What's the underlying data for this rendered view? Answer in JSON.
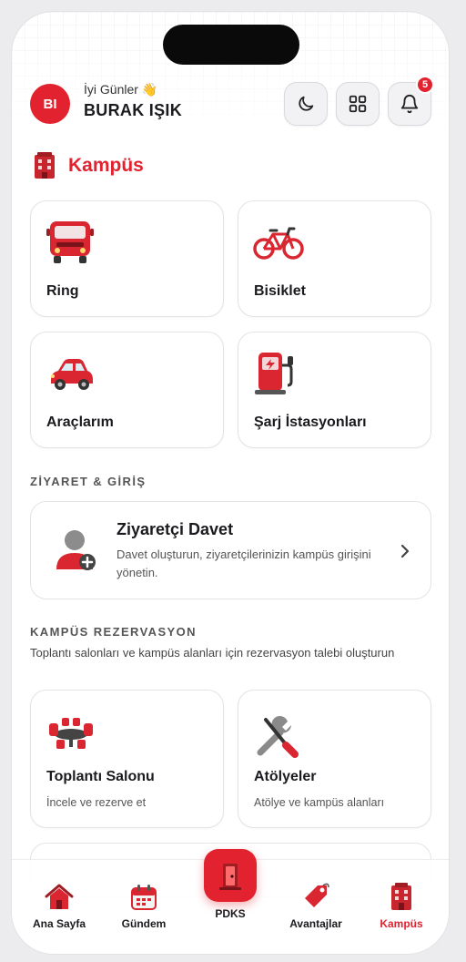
{
  "header": {
    "avatar_initials": "BI",
    "greeting": "İyi Günler 👋",
    "user_name": "BURAK IŞIK",
    "notification_count": "5"
  },
  "campus": {
    "title": "Kampüs",
    "tiles": [
      {
        "label": "Ring",
        "icon": "bus-icon"
      },
      {
        "label": "Bisiklet",
        "icon": "bicycle-icon"
      },
      {
        "label": "Araçlarım",
        "icon": "car-icon"
      },
      {
        "label": "Şarj İstasyonları",
        "icon": "ev-charger-icon"
      }
    ]
  },
  "visit": {
    "section_title": "ZİYARET & GİRİŞ",
    "card_title": "Ziyaretçi Davet",
    "card_desc": "Davet oluşturun, ziyaretçilerinizin kampüs girişini yönetin."
  },
  "reservation": {
    "section_title": "KAMPÜS REZERVASYON",
    "section_desc": "Toplantı salonları ve kampüs alanları için rezervasyon talebi oluşturun",
    "tiles": [
      {
        "label": "Toplantı Salonu",
        "sub": "İncele ve rezerve et",
        "icon": "meeting-table-icon"
      },
      {
        "label": "Atölyeler",
        "sub": "Atölye ve kampüs alanları",
        "icon": "tools-icon"
      }
    ]
  },
  "bottom_nav": {
    "items": [
      {
        "label": "Ana Sayfa",
        "icon": "home-icon"
      },
      {
        "label": "Gündem",
        "icon": "calendar-icon"
      },
      {
        "label": "PDKS",
        "icon": "door-icon"
      },
      {
        "label": "Avantajlar",
        "icon": "tag-icon"
      },
      {
        "label": "Kampüs",
        "icon": "building-icon",
        "active": true
      }
    ]
  },
  "colors": {
    "accent": "#e2222f",
    "text": "#1b1b1f",
    "muted": "#555555"
  }
}
